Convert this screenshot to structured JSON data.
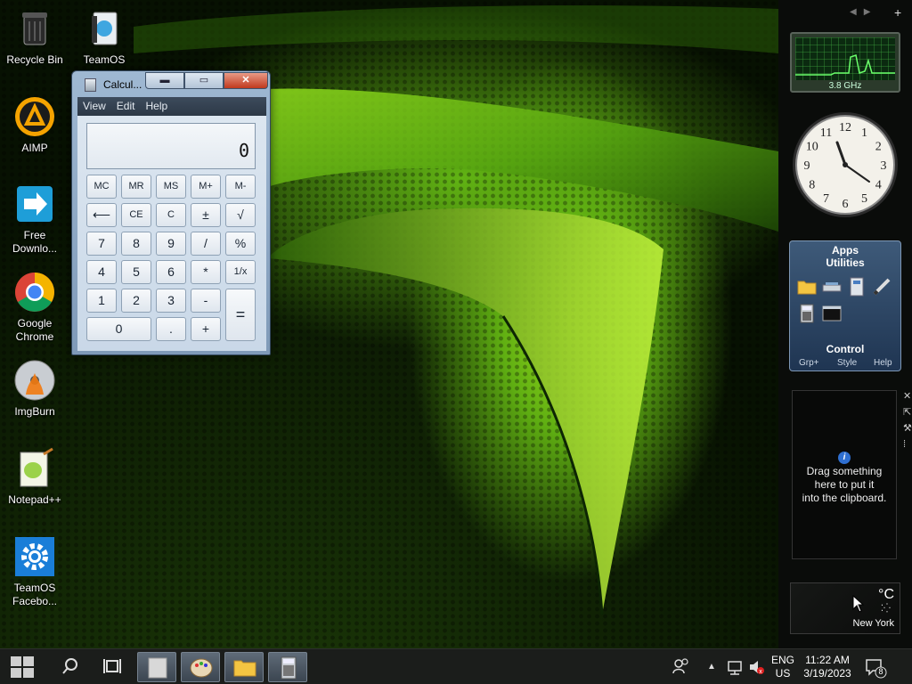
{
  "desktop": {
    "icons": [
      {
        "label": "Recycle Bin",
        "icon": "recycle-bin-icon"
      },
      {
        "label": "TeamOS",
        "icon": "teamos-folder-icon"
      },
      {
        "label": "AIMP",
        "icon": "aimp-icon"
      },
      {
        "label": "Free Downlo...",
        "icon": "free-download-manager-icon"
      },
      {
        "label": "Google Chrome",
        "icon": "chrome-icon"
      },
      {
        "label": "ImgBurn",
        "icon": "imgburn-icon"
      },
      {
        "label": "Notepad++",
        "icon": "notepadpp-icon"
      },
      {
        "label": "TeamOS Facebo...",
        "icon": "settings-gear-icon"
      }
    ]
  },
  "calculator": {
    "title": "Calcul...",
    "menu": [
      "View",
      "Edit",
      "Help"
    ],
    "display": "0",
    "keys": {
      "mc": "MC",
      "mr": "MR",
      "ms": "MS",
      "mplus": "M+",
      "mminus": "M-",
      "back": "⟵",
      "ce": "CE",
      "c": "C",
      "pm": "±",
      "sqrt": "√",
      "k7": "7",
      "k8": "8",
      "k9": "9",
      "div": "/",
      "pct": "%",
      "k4": "4",
      "k5": "5",
      "k6": "6",
      "mul": "*",
      "inv": "1/x",
      "k1": "1",
      "k2": "2",
      "k3": "3",
      "sub": "-",
      "eq": "=",
      "k0": "0",
      "dot": ".",
      "add": "+"
    }
  },
  "sidebar": {
    "cpu": {
      "label": "3.8 GHz"
    },
    "clock": {
      "numbers": [
        "12",
        "1",
        "2",
        "3",
        "4",
        "5",
        "6",
        "7",
        "8",
        "9",
        "10",
        "11"
      ]
    },
    "apps": {
      "title": "Apps",
      "group": "Utilities",
      "control": "Control",
      "footer": [
        "Grp+",
        "Style",
        "Help"
      ]
    },
    "clipboard": {
      "info": "i",
      "text_line1": "Drag something",
      "text_line2": "here to put it",
      "text_line3": "into the clipboard."
    },
    "weather": {
      "unit": "°C",
      "city": "New York"
    }
  },
  "taskbar": {
    "language": "ENG",
    "region": "US",
    "time": "11:22 AM",
    "date": "3/19/2023",
    "notifications": "8"
  }
}
